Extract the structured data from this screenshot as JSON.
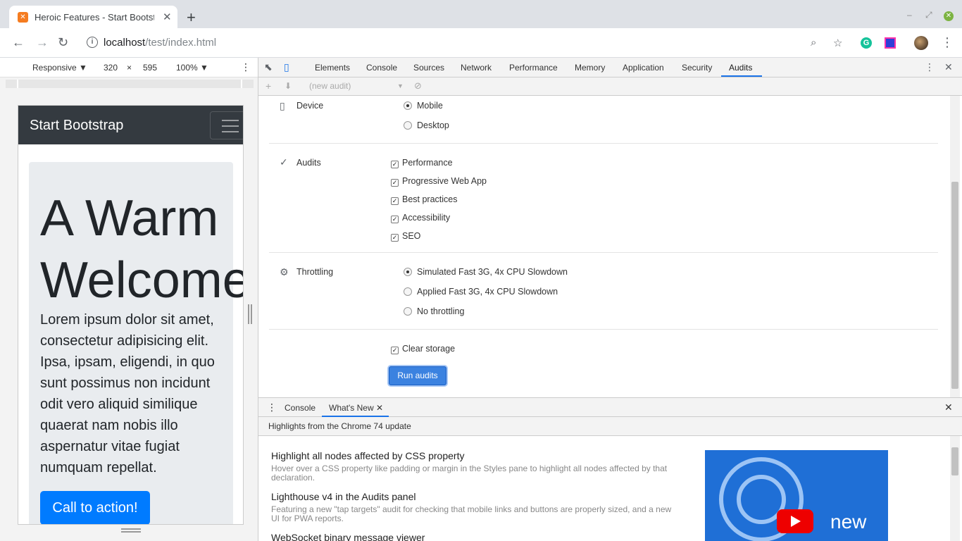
{
  "browser": {
    "tab_title": "Heroic Features - Start Bootstrap",
    "url_host": "localhost",
    "url_path": "/test/index.html"
  },
  "device_toolbar": {
    "device": "Responsive ▼",
    "width": "320",
    "times": "×",
    "height": "595",
    "zoom": "100% ▼"
  },
  "page": {
    "brand": "Start Bootstrap",
    "heading_line1": "A Warm",
    "heading_line2": "Welcome!",
    "lead": "Lorem ipsum dolor sit amet, consectetur adipisicing elit. Ipsa, ipsam, eligendi, in quo sunt possimus non incidunt odit vero aliquid similique quaerat nam nobis illo aspernatur vitae fugiat numquam repellat.",
    "cta": "Call to action!"
  },
  "devtools": {
    "tabs": [
      "Elements",
      "Console",
      "Sources",
      "Network",
      "Performance",
      "Memory",
      "Application",
      "Security",
      "Audits"
    ],
    "active_tab": "Audits",
    "audit_select": "(new audit)",
    "device_label": "Device",
    "device_options": [
      "Mobile",
      "Desktop"
    ],
    "audits_label": "Audits",
    "audit_options": [
      "Performance",
      "Progressive Web App",
      "Best practices",
      "Accessibility",
      "SEO"
    ],
    "throttling_label": "Throttling",
    "throttling_options": [
      "Simulated Fast 3G, 4x CPU Slowdown",
      "Applied Fast 3G, 4x CPU Slowdown",
      "No throttling"
    ],
    "clear_storage": "Clear storage",
    "run_button": "Run audits"
  },
  "drawer": {
    "tabs": [
      "Console",
      "What's New"
    ],
    "header": "Highlights from the Chrome 74 update",
    "items": [
      {
        "title": "Highlight all nodes affected by CSS property",
        "desc": "Hover over a CSS property like padding or margin in the Styles pane to highlight all nodes affected by that declaration."
      },
      {
        "title": "Lighthouse v4 in the Audits panel",
        "desc": "Featuring a new \"tap targets\" audit for checking that mobile links and buttons are properly sized, and a new UI for PWA reports."
      },
      {
        "title": "WebSocket binary message viewer",
        "desc": ""
      }
    ],
    "video_label": "new"
  },
  "colors": {
    "accent": "#1a73e8",
    "navbar": "#343a40",
    "cta": "#007bff",
    "run_button": "#3b82e0"
  }
}
